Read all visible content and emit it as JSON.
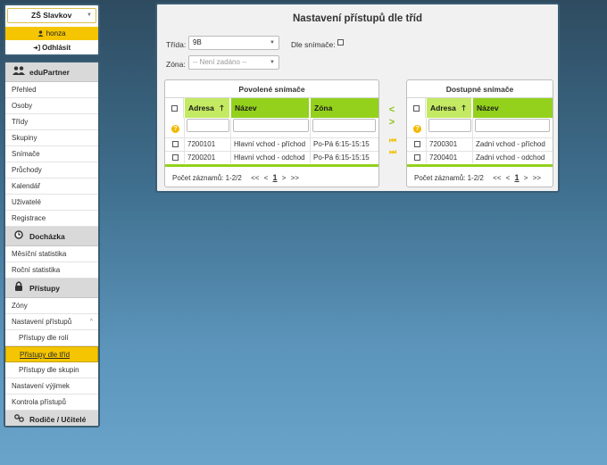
{
  "session": {
    "school": "ZŠ Slavkov",
    "user": "honza",
    "logout": "Odhlásit"
  },
  "sidebar": {
    "sections": [
      {
        "header": "eduPartner",
        "icon": "users-icon",
        "items": [
          "Přehled",
          "Osoby",
          "Třídy",
          "Skupiny",
          "Snímače",
          "Průchody",
          "Kalendář",
          "Uživatelé",
          "Registrace"
        ]
      },
      {
        "header": "Docházka",
        "icon": "clock-icon",
        "items": [
          "Měsíční statistika",
          "Roční statistika"
        ]
      },
      {
        "header": "Přístupy",
        "icon": "lock-icon",
        "items": [
          "Zóny",
          "Nastavení přístupů",
          "Přístupy dle rolí",
          "Přístupy dle tříd",
          "Přístupy dle skupin",
          "Nastavení výjimek",
          "Kontrola přístupů"
        ]
      },
      {
        "header": "Rodiče / Učitelé",
        "icon": "link-icon",
        "items": []
      }
    ],
    "active_item": "Přístupy dle tříd"
  },
  "main": {
    "title": "Nastavení přístupů dle tříd",
    "trida_label": "Třída:",
    "trida_value": "9B",
    "dle_snimace_label": "Dle snímače:",
    "zona_label": "Zóna:",
    "zona_placeholder": "-- Není zadáno --"
  },
  "allowed": {
    "title": "Povolené snímače",
    "columns": [
      "Adresa",
      "Název",
      "Zóna"
    ],
    "rows": [
      [
        "7200101",
        "Hlavní vchod - příchod",
        "Po-Pá 6:15-15:15"
      ],
      [
        "7200201",
        "Hlavní vchod - odchod",
        "Po-Pá 6:15-15:15"
      ]
    ],
    "count_label": "Počet záznamů: 1-2/2",
    "pager": {
      "first": "<<",
      "prev": "<",
      "page": "1",
      "next": ">",
      "last": ">>"
    }
  },
  "available": {
    "title": "Dostupné snímače",
    "columns": [
      "Adresa",
      "Název"
    ],
    "rows": [
      [
        "7200301",
        "Zadní vchod - příchod"
      ],
      [
        "7200401",
        "Zadní vchod - odchod"
      ]
    ],
    "count_label": "Počet záznamů: 1-2/2",
    "pager": {
      "first": "<<",
      "prev": "<",
      "page": "1",
      "next": ">",
      "last": ">>"
    }
  },
  "transfer": {
    "left": "<",
    "right": ">",
    "all_left": "⏮",
    "all_right": "⏭"
  },
  "colors": {
    "accent_yellow": "#f4c500",
    "header_green": "#93d11c",
    "frame_blue": "#3a5d75"
  }
}
